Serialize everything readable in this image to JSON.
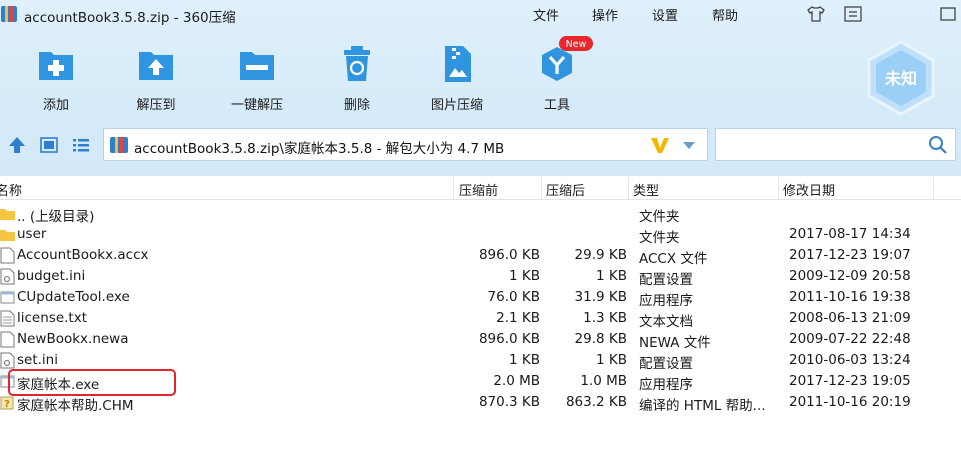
{
  "window": {
    "title": "accountBook3.5.8.zip - 360压缩",
    "menus": [
      "文件",
      "操作",
      "设置",
      "帮助"
    ]
  },
  "toolbar": {
    "tools": [
      {
        "label": "添加",
        "icon": "add-icon"
      },
      {
        "label": "解压到",
        "icon": "extract-to-icon"
      },
      {
        "label": "一键解压",
        "icon": "one-click-extract-icon"
      },
      {
        "label": "删除",
        "icon": "delete-icon"
      },
      {
        "label": "图片压缩",
        "icon": "image-compress-icon"
      },
      {
        "label": "工具",
        "icon": "tools-icon"
      }
    ],
    "new_badge": "New",
    "status_badge": "未知"
  },
  "address": {
    "path": "accountBook3.5.8.zip\\家庭帐本3.5.8 - 解包大小为 4.7 MB",
    "search_placeholder": ""
  },
  "columns": {
    "name": "名称",
    "size": "压缩前",
    "csize": "压缩后",
    "type": "类型",
    "date": "修改日期"
  },
  "files": [
    {
      "name": ".. (上级目录)",
      "size": "",
      "csize": "",
      "type": "文件夹",
      "date": "",
      "icon": "folder-icon"
    },
    {
      "name": "user",
      "size": "",
      "csize": "",
      "type": "文件夹",
      "date": "2017-08-17 14:34",
      "icon": "folder-icon"
    },
    {
      "name": "AccountBookx.accx",
      "size": "896.0 KB",
      "csize": "29.9 KB",
      "type": "ACCX 文件",
      "date": "2017-12-23 19:07",
      "icon": "file-icon"
    },
    {
      "name": "budget.ini",
      "size": "1 KB",
      "csize": "1 KB",
      "type": "配置设置",
      "date": "2009-12-09 20:58",
      "icon": "ini-file-icon"
    },
    {
      "name": "CUpdateTool.exe",
      "size": "76.0 KB",
      "csize": "31.9 KB",
      "type": "应用程序",
      "date": "2011-10-16 19:38",
      "icon": "exe-icon"
    },
    {
      "name": "license.txt",
      "size": "2.1 KB",
      "csize": "1.3 KB",
      "type": "文本文档",
      "date": "2008-06-13 21:09",
      "icon": "text-file-icon"
    },
    {
      "name": "NewBookx.newa",
      "size": "896.0 KB",
      "csize": "29.8 KB",
      "type": "NEWA 文件",
      "date": "2009-07-22 22:48",
      "icon": "file-icon"
    },
    {
      "name": "set.ini",
      "size": "1 KB",
      "csize": "1 KB",
      "type": "配置设置",
      "date": "2010-06-03 13:24",
      "icon": "ini-file-icon"
    },
    {
      "name": "家庭帐本.exe",
      "size": "2.0 MB",
      "csize": "1.0 MB",
      "type": "应用程序",
      "date": "2017-12-23 19:05",
      "icon": "exe-icon"
    },
    {
      "name": "家庭帐本帮助.CHM",
      "size": "870.3 KB",
      "csize": "863.2 KB",
      "type": "编译的 HTML 帮助...",
      "date": "2011-10-16 20:19",
      "icon": "chm-help-icon"
    }
  ],
  "colors": {
    "accent": "#2f95e0",
    "highlight": "#e0252b",
    "toolbar_bg": "#d6ebf9"
  }
}
